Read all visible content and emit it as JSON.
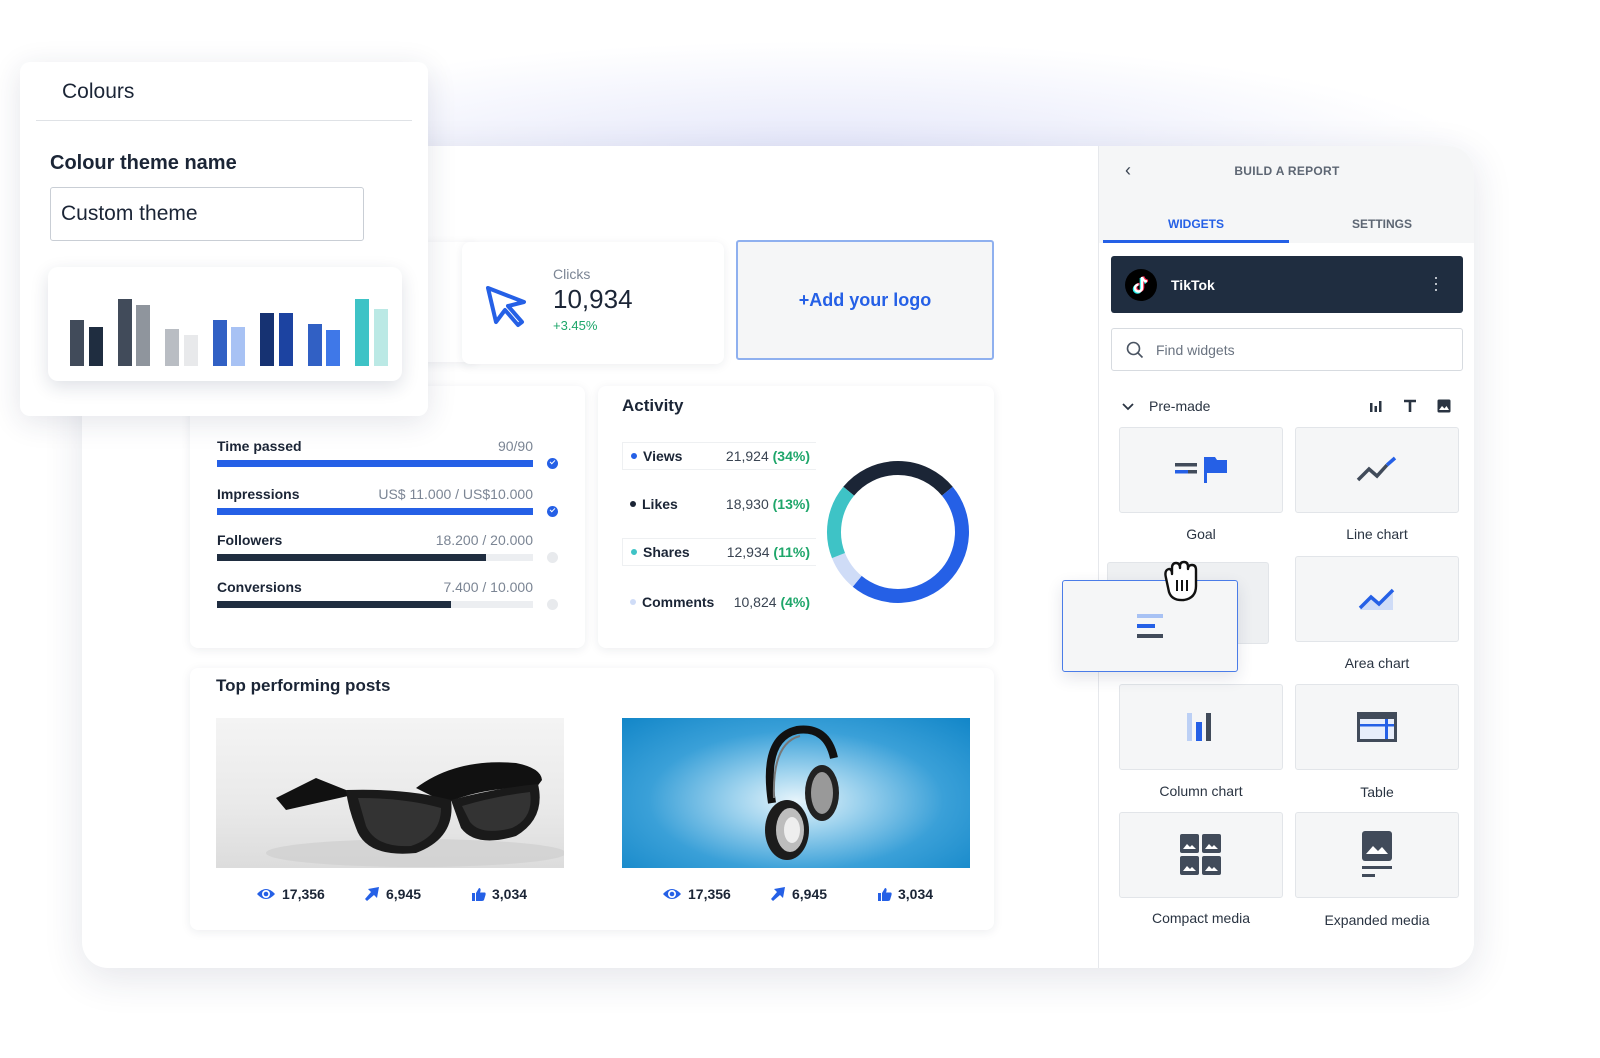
{
  "colours_panel": {
    "title": "Colours",
    "theme_name_label": "Colour theme name",
    "theme_name_value": "Custom theme",
    "palette": [
      {
        "color": "#414b5a",
        "level": 0.56
      },
      {
        "color": "#1f2d40",
        "level": 0.47
      },
      {
        "color": "#414b5a",
        "level": 0.82
      },
      {
        "color": "#8f959d",
        "level": 0.75
      },
      {
        "color": "#b9bdc3",
        "level": 0.45
      },
      {
        "color": "#e8e9eb",
        "level": 0.38
      },
      {
        "color": "#3160c4",
        "level": 0.56
      },
      {
        "color": "#a8c2f4",
        "level": 0.47
      },
      {
        "color": "#163272",
        "level": 0.65
      },
      {
        "color": "#1c43a1",
        "level": 0.65
      },
      {
        "color": "#3160c4",
        "level": 0.51
      },
      {
        "color": "#3f78e8",
        "level": 0.44
      },
      {
        "color": "#3ec3c6",
        "level": 0.82
      },
      {
        "color": "#bbe9e5",
        "level": 0.7
      }
    ]
  },
  "kpi": {
    "clicks_label": "Clicks",
    "clicks_value": "10,934",
    "clicks_delta": "+3.45%",
    "add_logo": "+Add your logo"
  },
  "goals": [
    {
      "name": "Time passed",
      "value": "90/90",
      "progress": 1.0,
      "color": "#2560e6",
      "done": true
    },
    {
      "name": "Impressions",
      "value": "US$ 11.000 / US$10.000",
      "progress": 1.0,
      "color": "#2560e6",
      "done": true
    },
    {
      "name": "Followers",
      "value": "18.200 / 20.000",
      "progress": 0.85,
      "color": "#1f2d40",
      "done": false
    },
    {
      "name": "Conversions",
      "value": "7.400 / 10.000",
      "progress": 0.74,
      "color": "#1f2d40",
      "done": false
    }
  ],
  "activity": {
    "title": "Activity",
    "rows": [
      {
        "name": "Views",
        "value": "21,924",
        "pct": "(34%)",
        "color": "#2560e6",
        "share": 0.47
      },
      {
        "name": "Likes",
        "value": "18,930",
        "pct": "(13%)",
        "color": "#1b2536",
        "share": 0.28
      },
      {
        "name": "Shares",
        "value": "12,934",
        "pct": "(11%)",
        "color": "#3ec3c6",
        "share": 0.17
      },
      {
        "name": "Comments",
        "value": "10,824",
        "pct": "(4%)",
        "color": "#cfdcf7",
        "share": 0.08
      }
    ]
  },
  "posts": {
    "title": "Top performing posts",
    "items": [
      {
        "subject": "sunglasses",
        "views": "17,356",
        "shares": "6,945",
        "likes": "3,034"
      },
      {
        "subject": "headphones",
        "views": "17,356",
        "shares": "6,945",
        "likes": "3,034"
      }
    ]
  },
  "panel": {
    "title": "BUILD A REPORT",
    "back": "‹",
    "tabs": [
      {
        "label": "WIDGETS",
        "active": true
      },
      {
        "label": "SETTINGS",
        "active": false
      }
    ],
    "source": "TikTok",
    "search_placeholder": "Find widgets",
    "section": "Pre-made",
    "widgets": [
      {
        "label": "Goal",
        "icon": "goal-icon"
      },
      {
        "label": "Line chart",
        "icon": "line-chart-icon"
      },
      {
        "label": "",
        "icon": "bar-chart-icon"
      },
      {
        "label": "Area chart",
        "icon": "area-chart-icon"
      },
      {
        "label": "Column chart",
        "icon": "column-chart-icon"
      },
      {
        "label": "Table",
        "icon": "table-icon"
      },
      {
        "label": "Compact media",
        "icon": "compact-media-icon"
      },
      {
        "label": "Expanded media",
        "icon": "expanded-media-icon"
      }
    ]
  }
}
